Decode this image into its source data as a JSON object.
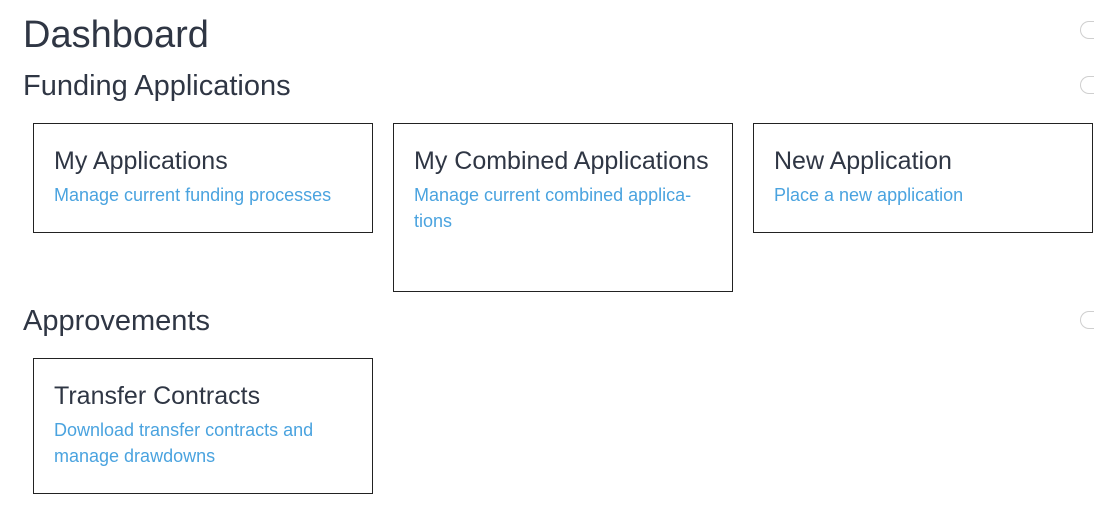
{
  "dashboard": {
    "title": "Dashboard"
  },
  "sections": {
    "funding": {
      "title": "Funding Applications",
      "cards": [
        {
          "title": "My Applications",
          "description": "Manage current funding processes"
        },
        {
          "title": "My Combined Applications",
          "description": "Manage current combined applica-tions"
        },
        {
          "title": "New Application",
          "description": "Place a new application"
        }
      ]
    },
    "approvements": {
      "title": "Approvements",
      "cards": [
        {
          "title": "Transfer Contracts",
          "description": "Download transfer contracts and manage drawdowns"
        }
      ]
    }
  },
  "icons": {
    "collapse_toggle": "collapse-toggle-icon"
  },
  "colors": {
    "heading": "#2f3644",
    "link": "#4aa3df",
    "card_border": "#222222"
  }
}
